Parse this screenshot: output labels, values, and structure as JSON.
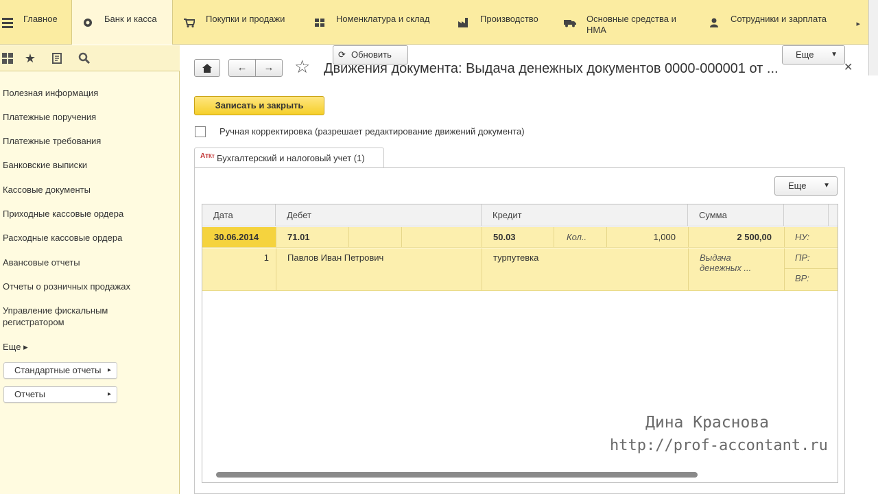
{
  "sections": {
    "items": [
      {
        "label": "Главное",
        "icon": "none"
      },
      {
        "label": "Банк и касса",
        "icon": "coin-icon"
      },
      {
        "label": "Покупки и продажи",
        "icon": "cart-icon"
      },
      {
        "label": "Номенклатура и склад",
        "icon": "warehouse-icon"
      },
      {
        "label": "Производство",
        "icon": "factory-icon"
      },
      {
        "label": "Основные средства и",
        "label2": "НМА",
        "icon": "truck-icon"
      },
      {
        "label": "Сотрудники и зарплата",
        "icon": "person-icon"
      }
    ],
    "more": "▸"
  },
  "sidebar": {
    "items": [
      "Полезная информация",
      "Платежные поручения",
      "Платежные требования",
      "Банковские выписки",
      "Кассовые документы",
      "Приходные кассовые ордера",
      "Расходные кассовые ордера",
      "Авансовые отчеты",
      "Отчеты о розничных продажах",
      "Управление фискальным",
      "регистратором"
    ],
    "more": "Еще ▸",
    "buttons": [
      "Стандартные отчеты",
      "Отчеты"
    ]
  },
  "form": {
    "title": "Движения документа: Выдача денежных документов 0000-000001 от ...",
    "save_close": "Записать и закрыть",
    "refresh": "Обновить",
    "more": "Еще",
    "manual_edit": "Ручная корректировка (разрешает редактирование движений документа)",
    "tab": "Бухгалтерский и налоговый учет (1)",
    "grid_more": "Еще"
  },
  "grid": {
    "headers": [
      "Дата",
      "Дебет",
      "Кредит",
      "Сумма"
    ],
    "rows": [
      {
        "date": "30.06.2014",
        "debit": "71.01",
        "credit": "50.03",
        "credit_extra": "Кол..",
        "qty": "1,000",
        "sum": "2 500,00",
        "nu": "НУ:",
        "number": "1",
        "debit_sub": "Павлов Иван Петрович",
        "credit_sub": "турпутевка",
        "content1": "Выдача",
        "content2": "денежных ...",
        "pr": "ПР:",
        "vr": "ВР:"
      }
    ]
  },
  "watermark": {
    "name": "Дина Краснова",
    "url": "http://prof-accontant.ru"
  },
  "colors": {
    "section_bar": "#fbeca1",
    "sidebar": "#fffbe0",
    "accent_button": "#f5cf2a",
    "selected_row": "#fcefae"
  }
}
